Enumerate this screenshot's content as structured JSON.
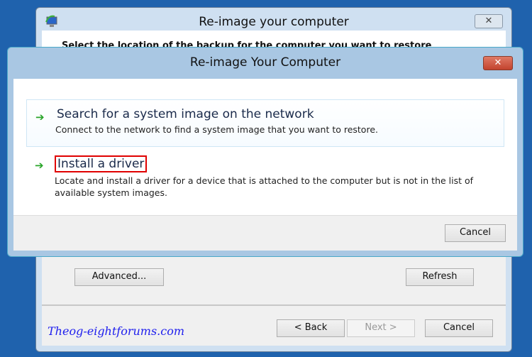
{
  "back_window": {
    "title": "Re-image your computer",
    "close": "✕",
    "heading": "Select the location of the backup for the computer you want to restore",
    "advanced": "Advanced...",
    "refresh": "Refresh",
    "back": "< Back",
    "next": "Next >",
    "cancel": "Cancel",
    "watermark": "Theog-eightforums.com"
  },
  "dialog": {
    "title": "Re-image Your Computer",
    "close": "✕",
    "options": [
      {
        "title": "Search for a system image on the network",
        "description": "Connect to the network to find a system image that you want to restore.",
        "icon": "green-arrow-icon"
      },
      {
        "title": "Install a driver",
        "description": "Locate and install a driver for a device that is attached to the computer but is not in the list of available system images.",
        "icon": "green-arrow-icon",
        "highlighted": true
      }
    ],
    "cancel": "Cancel"
  }
}
